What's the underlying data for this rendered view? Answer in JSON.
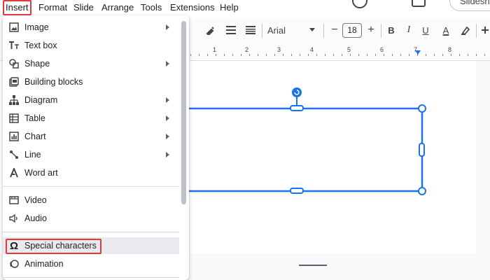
{
  "menubar": {
    "items": [
      "Insert",
      "Format",
      "Slide",
      "Arrange",
      "Tools",
      "Extensions",
      "Help"
    ],
    "share_label": "Slidesh"
  },
  "toolbar": {
    "font": "Arial",
    "font_size": "18",
    "minus": "−",
    "plus": "+",
    "bold": "B",
    "italic": "I",
    "underline": "U",
    "text_color": "A"
  },
  "ruler": {
    "numbers": [
      "1",
      "2",
      "3",
      "4",
      "5",
      "6",
      "7",
      "8"
    ]
  },
  "insert_menu": {
    "items": [
      {
        "label": "Image",
        "icon": "image-icon",
        "submenu": true
      },
      {
        "label": "Text box",
        "icon": "text-box-icon",
        "submenu": false
      },
      {
        "label": "Shape",
        "icon": "shape-icon",
        "submenu": true
      },
      {
        "label": "Building blocks",
        "icon": "building-blocks-icon",
        "submenu": false
      },
      {
        "label": "Diagram",
        "icon": "diagram-icon",
        "submenu": true
      },
      {
        "label": "Table",
        "icon": "table-icon",
        "submenu": true
      },
      {
        "label": "Chart",
        "icon": "chart-icon",
        "submenu": true
      },
      {
        "label": "Line",
        "icon": "line-icon",
        "submenu": true
      },
      {
        "label": "Word art",
        "icon": "word-art-icon",
        "submenu": false
      },
      {
        "label": "Video",
        "icon": "video-icon",
        "submenu": false
      },
      {
        "label": "Audio",
        "icon": "audio-icon",
        "submenu": false
      },
      {
        "label": "Special characters",
        "icon": "omega-icon",
        "submenu": false,
        "highlighted": true
      },
      {
        "label": "Animation",
        "icon": "animation-icon",
        "submenu": false
      }
    ]
  },
  "colors": {
    "highlight_border": "#e03a3a",
    "selection_blue": "#1a73e8"
  }
}
